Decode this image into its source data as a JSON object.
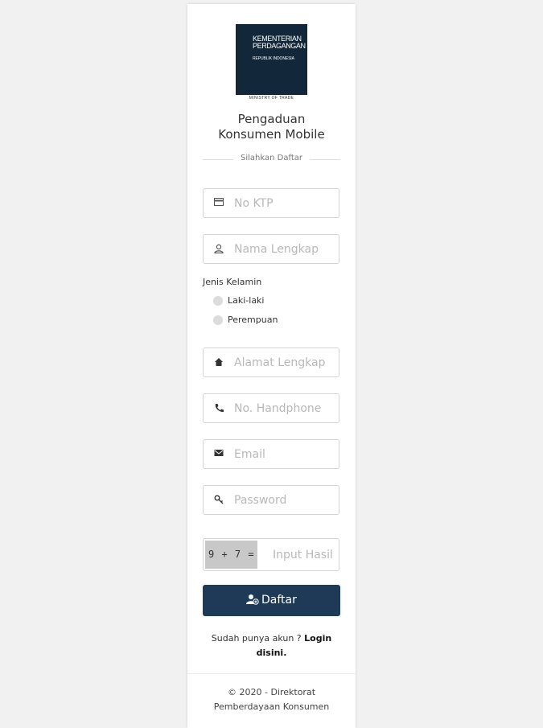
{
  "logo": {
    "line1": "KEMENTERIAN",
    "line2": "PERDAGANGAN",
    "line3": "REPUBLIK INDONESIA",
    "caption": "MINISTRY OF TRADE"
  },
  "title": {
    "line1": "Pengaduan",
    "line2": "Konsumen Mobile"
  },
  "divider_text": "Silahkan Daftar",
  "fields": {
    "ktp": {
      "placeholder": "No KTP",
      "icon": "card-icon"
    },
    "name": {
      "placeholder": "Nama Lengkap",
      "icon": "user-icon"
    },
    "address": {
      "placeholder": "Alamat Lengkap",
      "icon": "home-icon"
    },
    "phone": {
      "placeholder": "No. Handphone",
      "icon": "phone-icon"
    },
    "email": {
      "placeholder": "Email",
      "icon": "envelope-icon"
    },
    "password": {
      "placeholder": "Password",
      "icon": "key-icon"
    },
    "captcha": {
      "question": "9 + 7 =",
      "placeholder": "Input Hasil"
    }
  },
  "gender": {
    "label": "Jenis Kelamin",
    "options": [
      "Laki-laki",
      "Perempuan"
    ]
  },
  "submit": {
    "label": "Daftar",
    "icon": "user-plus-icon"
  },
  "login": {
    "prompt": "Sudah punya akun ?",
    "link_line1": "Login",
    "link_line2": "disini."
  },
  "footer": {
    "line1": "© 2020 - Direktorat",
    "line2": "Pemberdayaan Konsumen"
  },
  "colors": {
    "brand_dark": "#12283a",
    "button": "#1e3a56",
    "background": "#f1f1f1"
  }
}
